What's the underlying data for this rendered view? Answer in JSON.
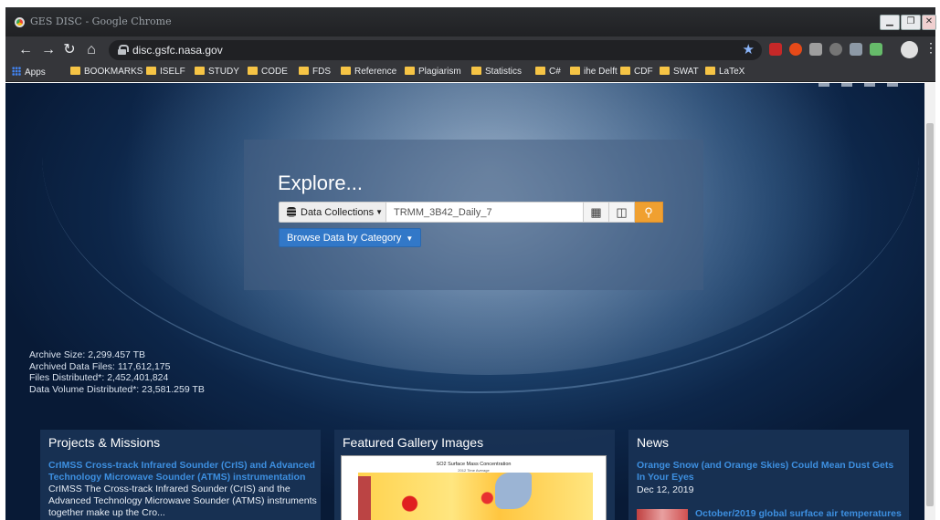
{
  "window": {
    "title": "GES DISC - Google Chrome"
  },
  "browser": {
    "url": "disc.gsfc.nasa.gov",
    "bookmarks": [
      "Apps",
      "BOOKMARKS",
      "ISELF",
      "STUDY",
      "CODE",
      "FDS",
      "Reference",
      "Plagiarism",
      "Statistics",
      "C#",
      "ihe Delft",
      "CDF",
      "SWAT",
      "LaTeX"
    ]
  },
  "explore": {
    "title": "Explore...",
    "collection_label": "Data Collections",
    "search_value": "TRMM_3B42_Daily_7",
    "browse_label": "Browse Data by Category"
  },
  "stats": {
    "archive_size": "Archive Size: 2,299.457 TB",
    "archived_files": "Archived Data Files: 117,612,175",
    "files_distributed": "Files Distributed*: 2,452,401,824",
    "volume_distributed": "Data Volume Distributed*: 23,581.259 TB"
  },
  "projects": {
    "title": "Projects & Missions",
    "link": "CrIMSS Cross-track Infrared Sounder (CrIS) and Advanced Technology Microwave Sounder (ATMS) instrumentation",
    "text": "CrIMSS  The Cross-track Infrared Sounder (CrIS) and the Advanced Technology Microwave Sounder (ATMS) instruments together make up the Cro..."
  },
  "gallery": {
    "title": "Featured Gallery Images",
    "image_title": "SO2 Surface Mass Concentration",
    "image_subtitle": "2012 Time Average"
  },
  "news": {
    "title": "News",
    "item1_title": "Orange Snow (and Orange Skies) Could Mean Dust Gets In Your Eyes",
    "item1_date": "Dec 12, 2019",
    "item2_title": "October/2019 global surface air temperatures"
  },
  "colors": {
    "accent": "#f0a030",
    "link": "#3d8fe0",
    "button": "#3278c8"
  }
}
